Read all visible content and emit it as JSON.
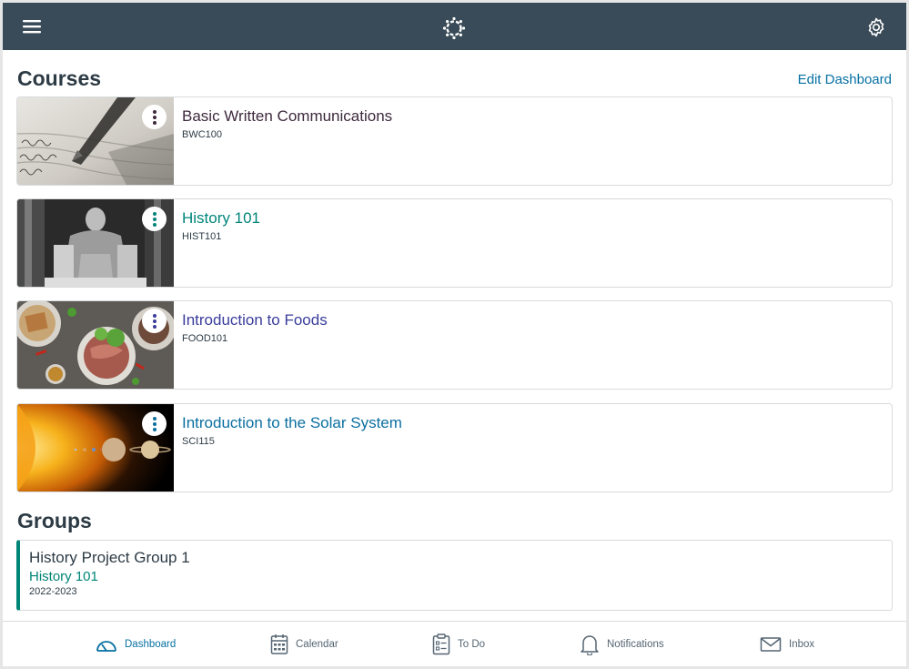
{
  "sections": {
    "courses_title": "Courses",
    "edit_dashboard": "Edit Dashboard",
    "groups_title": "Groups"
  },
  "courses": [
    {
      "name": "Basic Written Communications",
      "code": "BWC100",
      "color": "#3e2a3d"
    },
    {
      "name": "History 101",
      "code": "HIST101",
      "color": "#00857a"
    },
    {
      "name": "Introduction to Foods",
      "code": "FOOD101",
      "color": "#3a3d9c"
    },
    {
      "name": "Introduction to the Solar System",
      "code": "SCI115",
      "color": "#0b6fa0"
    }
  ],
  "groups": [
    {
      "name": "History Project Group 1",
      "course": "History 101",
      "term": "2022-2023"
    }
  ],
  "tabs": [
    {
      "label": "Dashboard",
      "icon": "dashboard-icon"
    },
    {
      "label": "Calendar",
      "icon": "calendar-icon"
    },
    {
      "label": "To Do",
      "icon": "todo-icon"
    },
    {
      "label": "Notifications",
      "icon": "bell-icon"
    },
    {
      "label": "Inbox",
      "icon": "envelope-icon"
    }
  ],
  "colors": {
    "header": "#394b58",
    "link": "#0770a3",
    "text": "#2d3b45",
    "group_accent": "#008577"
  }
}
